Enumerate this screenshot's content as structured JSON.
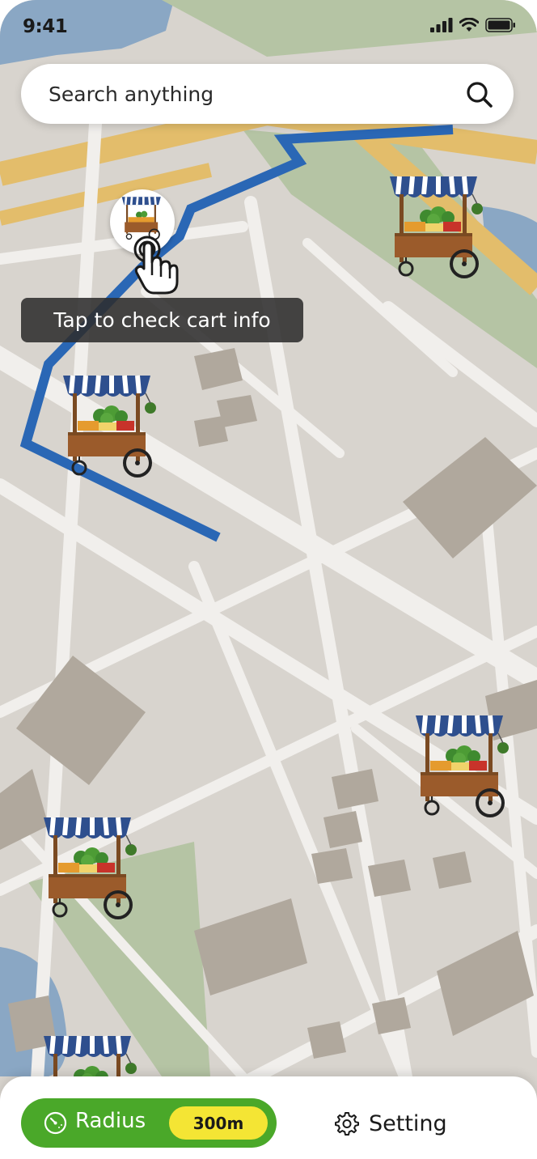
{
  "status_bar": {
    "time": "9:41",
    "icons": [
      "cellular-signal-icon",
      "wifi-icon",
      "battery-icon"
    ]
  },
  "search": {
    "placeholder": "Search anything",
    "icon": "search-icon"
  },
  "map": {
    "route_color": "#2a67b5",
    "selected_marker_hint": "Tap to check cart info",
    "cart_markers": [
      "cart-1",
      "cart-2",
      "cart-3",
      "cart-4",
      "cart-5",
      "cart-6"
    ]
  },
  "bottom_bar": {
    "radius": {
      "label": "Radius",
      "value": "300m",
      "icon": "radius-gauge-icon",
      "color": "#4aa829",
      "value_color": "#f4e534"
    },
    "setting": {
      "label": "Setting",
      "icon": "gear-icon"
    }
  }
}
